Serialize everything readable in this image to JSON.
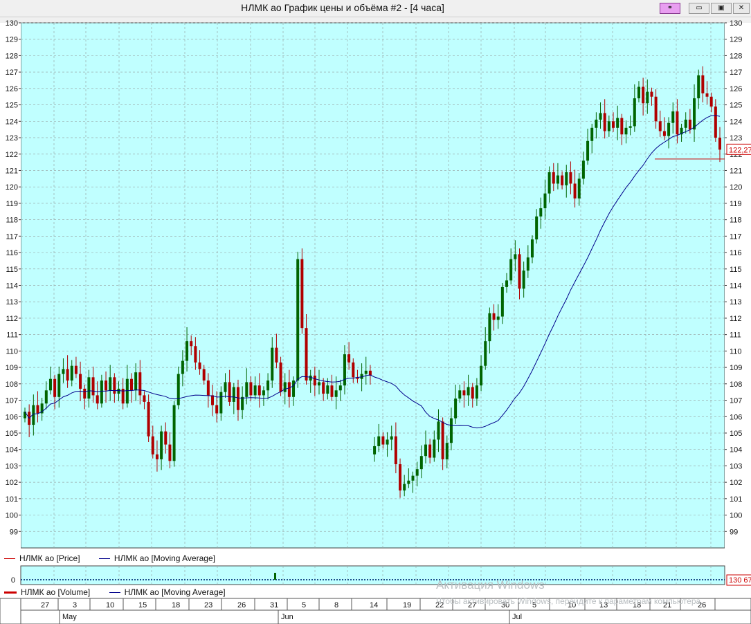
{
  "window": {
    "title": "НЛМК ао График цены и объёма #2 - [4 часа]",
    "buttons": [
      "link",
      "minimize",
      "restore",
      "close"
    ]
  },
  "colors": {
    "background": "#c0ffff",
    "up_candle": "#006400",
    "down_candle": "#b00000",
    "moving_average": "#00008b",
    "grid": "#9aaaaa",
    "price_marker": "#cc0000"
  },
  "legend_price": {
    "price_label": "НЛМК ао [Price]",
    "ma_label": "НЛМК ао [Moving Average]"
  },
  "legend_volume": {
    "volume_label": "НЛМК ао [Volume]",
    "ma_label": "НЛМК ао [Moving Average]"
  },
  "volume_panel": {
    "axis_label": "0",
    "last_value": "130 67"
  },
  "watermark": {
    "title": "Активация Windows",
    "text": "Чтобы активировать Windows, перейдите к параметрам компьютера."
  },
  "chart_data": [
    {
      "type": "candlestick",
      "title": "",
      "ylim": [
        98,
        130
      ],
      "y_ticks": [
        99,
        100,
        101,
        102,
        103,
        104,
        105,
        106,
        107,
        108,
        109,
        110,
        111,
        112,
        113,
        114,
        115,
        116,
        117,
        118,
        119,
        120,
        121,
        122,
        123,
        124,
        125,
        126,
        127,
        128,
        129,
        130
      ],
      "last_price": "122,27",
      "day_labels": [
        "27",
        "3",
        "10",
        "15",
        "18",
        "23",
        "26",
        "31",
        "5",
        "8",
        "14",
        "19",
        "22",
        "27",
        "30",
        "5",
        "10",
        "13",
        "18",
        "21",
        "26"
      ],
      "month_labels": [
        "May",
        "Jun",
        "Jul"
      ],
      "grid": true,
      "series": [
        {
          "name": "НЛМК ао [Price]",
          "role": "ohlc",
          "notes": "4-hour candles",
          "close": [
            106.3,
            105.5,
            106.7,
            106.2,
            106.8,
            107.6,
            108.3,
            107.2,
            108.6,
            108.9,
            108.2,
            109.1,
            108.6,
            107.7,
            107.1,
            108.4,
            107.3,
            106.8,
            108.2,
            107.6,
            108.4,
            107.4,
            107.7,
            106.8,
            108.3,
            107.6,
            108.7,
            107.3,
            106.9,
            104.8,
            103.7,
            103.4,
            105.1,
            104.3,
            103.3,
            106.7,
            108.6,
            109.4,
            110.6,
            110.3,
            109.3,
            108.9,
            108.2,
            107.3,
            106.7,
            106.2,
            107.5,
            108.1,
            106.9,
            107.8,
            106.4,
            107.2,
            108.1,
            107.3,
            107.9,
            107.3,
            107.6,
            108.2,
            110.2,
            109.3,
            107.5,
            108.1,
            107.2,
            108.2,
            115.6,
            111.4,
            108.2,
            108.5,
            107.9,
            108.1,
            107.4,
            107.9,
            107.2,
            107.6,
            107.9,
            109.8,
            109.3,
            108.4,
            108.3,
            108.6,
            108.8,
            108.5,
            104.2,
            104.8,
            104.3,
            104.6,
            104.8,
            103.1,
            101.5,
            101.9,
            102.1,
            102.4,
            102.8,
            103.6,
            104.3,
            103.5,
            104.6,
            105.7,
            103.4,
            104.4,
            105.9,
            107.1,
            107.6,
            107.3,
            107.8,
            107.1,
            107.9,
            109.1,
            110.6,
            112.3,
            111.9,
            112.1,
            113.9,
            114.3,
            115.6,
            115.9,
            113.8,
            114.9,
            115.7,
            116.8,
            118.2,
            118.7,
            119.6,
            120.9,
            120.2,
            120.7,
            120.1,
            120.9,
            120.2,
            119.3,
            120.5,
            121.6,
            122.8,
            123.6,
            124.1,
            124.5,
            123.4,
            124.0,
            123.6,
            124.2,
            123.2,
            123.6,
            123.7,
            125.4,
            126.1,
            125.1,
            125.8,
            125.5,
            124.0,
            123.4,
            123.1,
            123.9,
            124.6,
            123.2,
            123.6,
            124.1,
            123.5,
            125.4,
            126.8,
            125.7,
            125.5,
            124.9,
            123.0,
            122.27
          ]
        }
      ]
    },
    {
      "type": "bar",
      "title": "",
      "ylim": [
        0,
        1
      ],
      "series": [
        {
          "name": "НЛМК ао [Volume]"
        }
      ]
    }
  ]
}
